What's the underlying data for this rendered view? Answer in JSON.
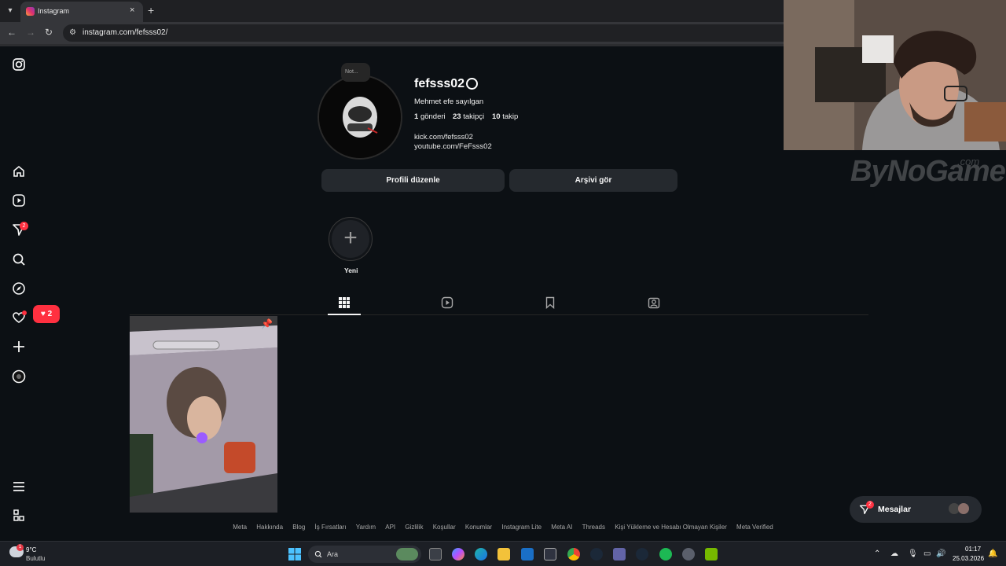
{
  "browser": {
    "tab_title": "Instagram",
    "url": "instagram.com/fefsss02/",
    "tab_close": "×",
    "new_tab": "+"
  },
  "nav": {
    "messages_badge": "2",
    "notifications_count": "2"
  },
  "profile": {
    "note_text": "Not...",
    "username": "fefsss02",
    "full_name": "Mehmet efe sayılgan",
    "posts_count": "1",
    "posts_label": "gönderi",
    "followers_count": "23",
    "followers_label": "takipçi",
    "following_count": "10",
    "following_label": "takip",
    "links": [
      "kick.com/fefsss02",
      "youtube.com/FeFsss02"
    ],
    "edit_button": "Profili düzenle",
    "archive_button": "Arşivi gör",
    "new_highlight_label": "Yeni"
  },
  "footer": [
    "Meta",
    "Hakkında",
    "Blog",
    "İş Fırsatları",
    "Yardım",
    "API",
    "Gizlilik",
    "Koşullar",
    "Konumlar",
    "Instagram Lite",
    "Meta AI",
    "Threads",
    "Kişi Yükleme ve Hesabı Olmayan Kişiler",
    "Meta Verified"
  ],
  "messages": {
    "label": "Mesajlar",
    "badge": "2"
  },
  "overlay": {
    "logo": "ByNoGame",
    "logo_suffix": ".com"
  },
  "taskbar": {
    "weather_temp": "9°C",
    "weather_desc": "Bulutlu",
    "search_placeholder": "Ara",
    "time": "01:17",
    "date": "25.03.2026"
  }
}
